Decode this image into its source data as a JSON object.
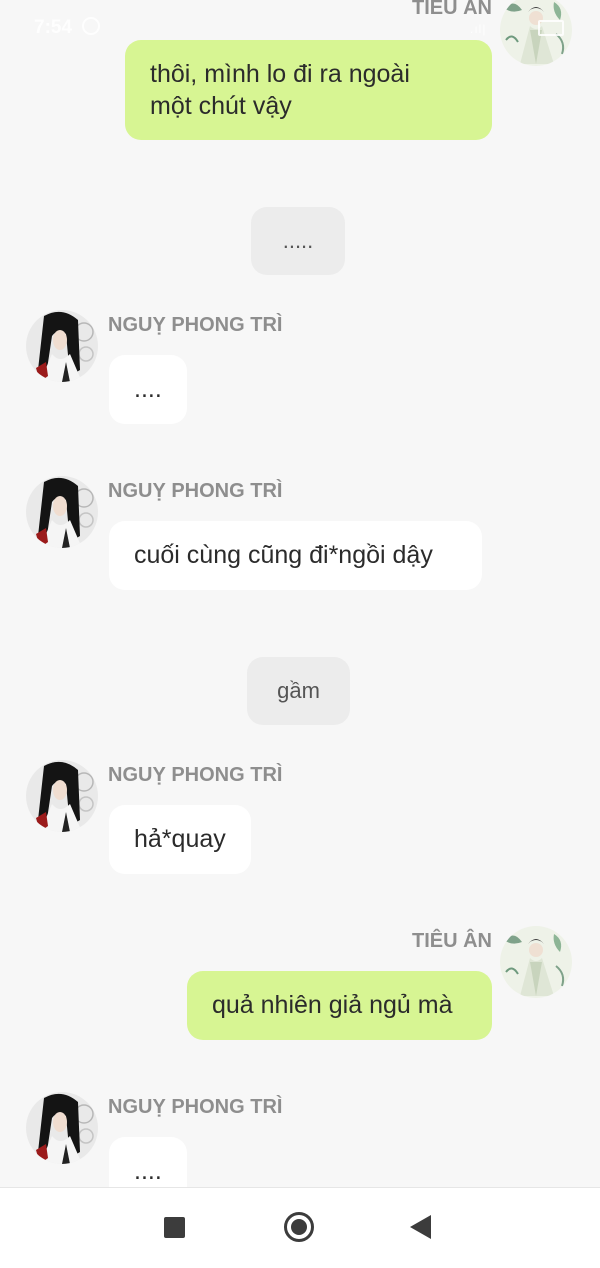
{
  "status_bar": {
    "time": "7:54"
  },
  "messages": [
    {
      "kind": "outgoing",
      "sender": "TIÊU ÂN",
      "lines": [
        "thôi, mình lo đi ra ngoài",
        "một chút vậy"
      ]
    },
    {
      "kind": "narration",
      "text": "....."
    },
    {
      "kind": "incoming",
      "sender": "NGUỴ PHONG TRÌ",
      "text": "...."
    },
    {
      "kind": "incoming",
      "sender": "NGUỴ PHONG TRÌ",
      "text": "cuối cùng cũng đi*ngồi dậy"
    },
    {
      "kind": "narration",
      "text": "gầm"
    },
    {
      "kind": "incoming",
      "sender": "NGUỴ PHONG TRÌ",
      "text": "hả*quay"
    },
    {
      "kind": "outgoing",
      "sender": "TIÊU ÂN",
      "text": "quả nhiên giả ngủ mà"
    },
    {
      "kind": "incoming",
      "sender": "NGUỴ PHONG TRÌ",
      "text": "...."
    }
  ],
  "nav_bar": {
    "recents_icon": "square-icon",
    "home_icon": "circle-home-icon",
    "back_icon": "triangle-back-icon"
  },
  "colors": {
    "background": "#f7f7f7",
    "outgoing_bubble": "#d7f593",
    "incoming_bubble": "#ffffff",
    "narration_bubble": "#ececec",
    "sender_text": "#8e8e8e"
  }
}
